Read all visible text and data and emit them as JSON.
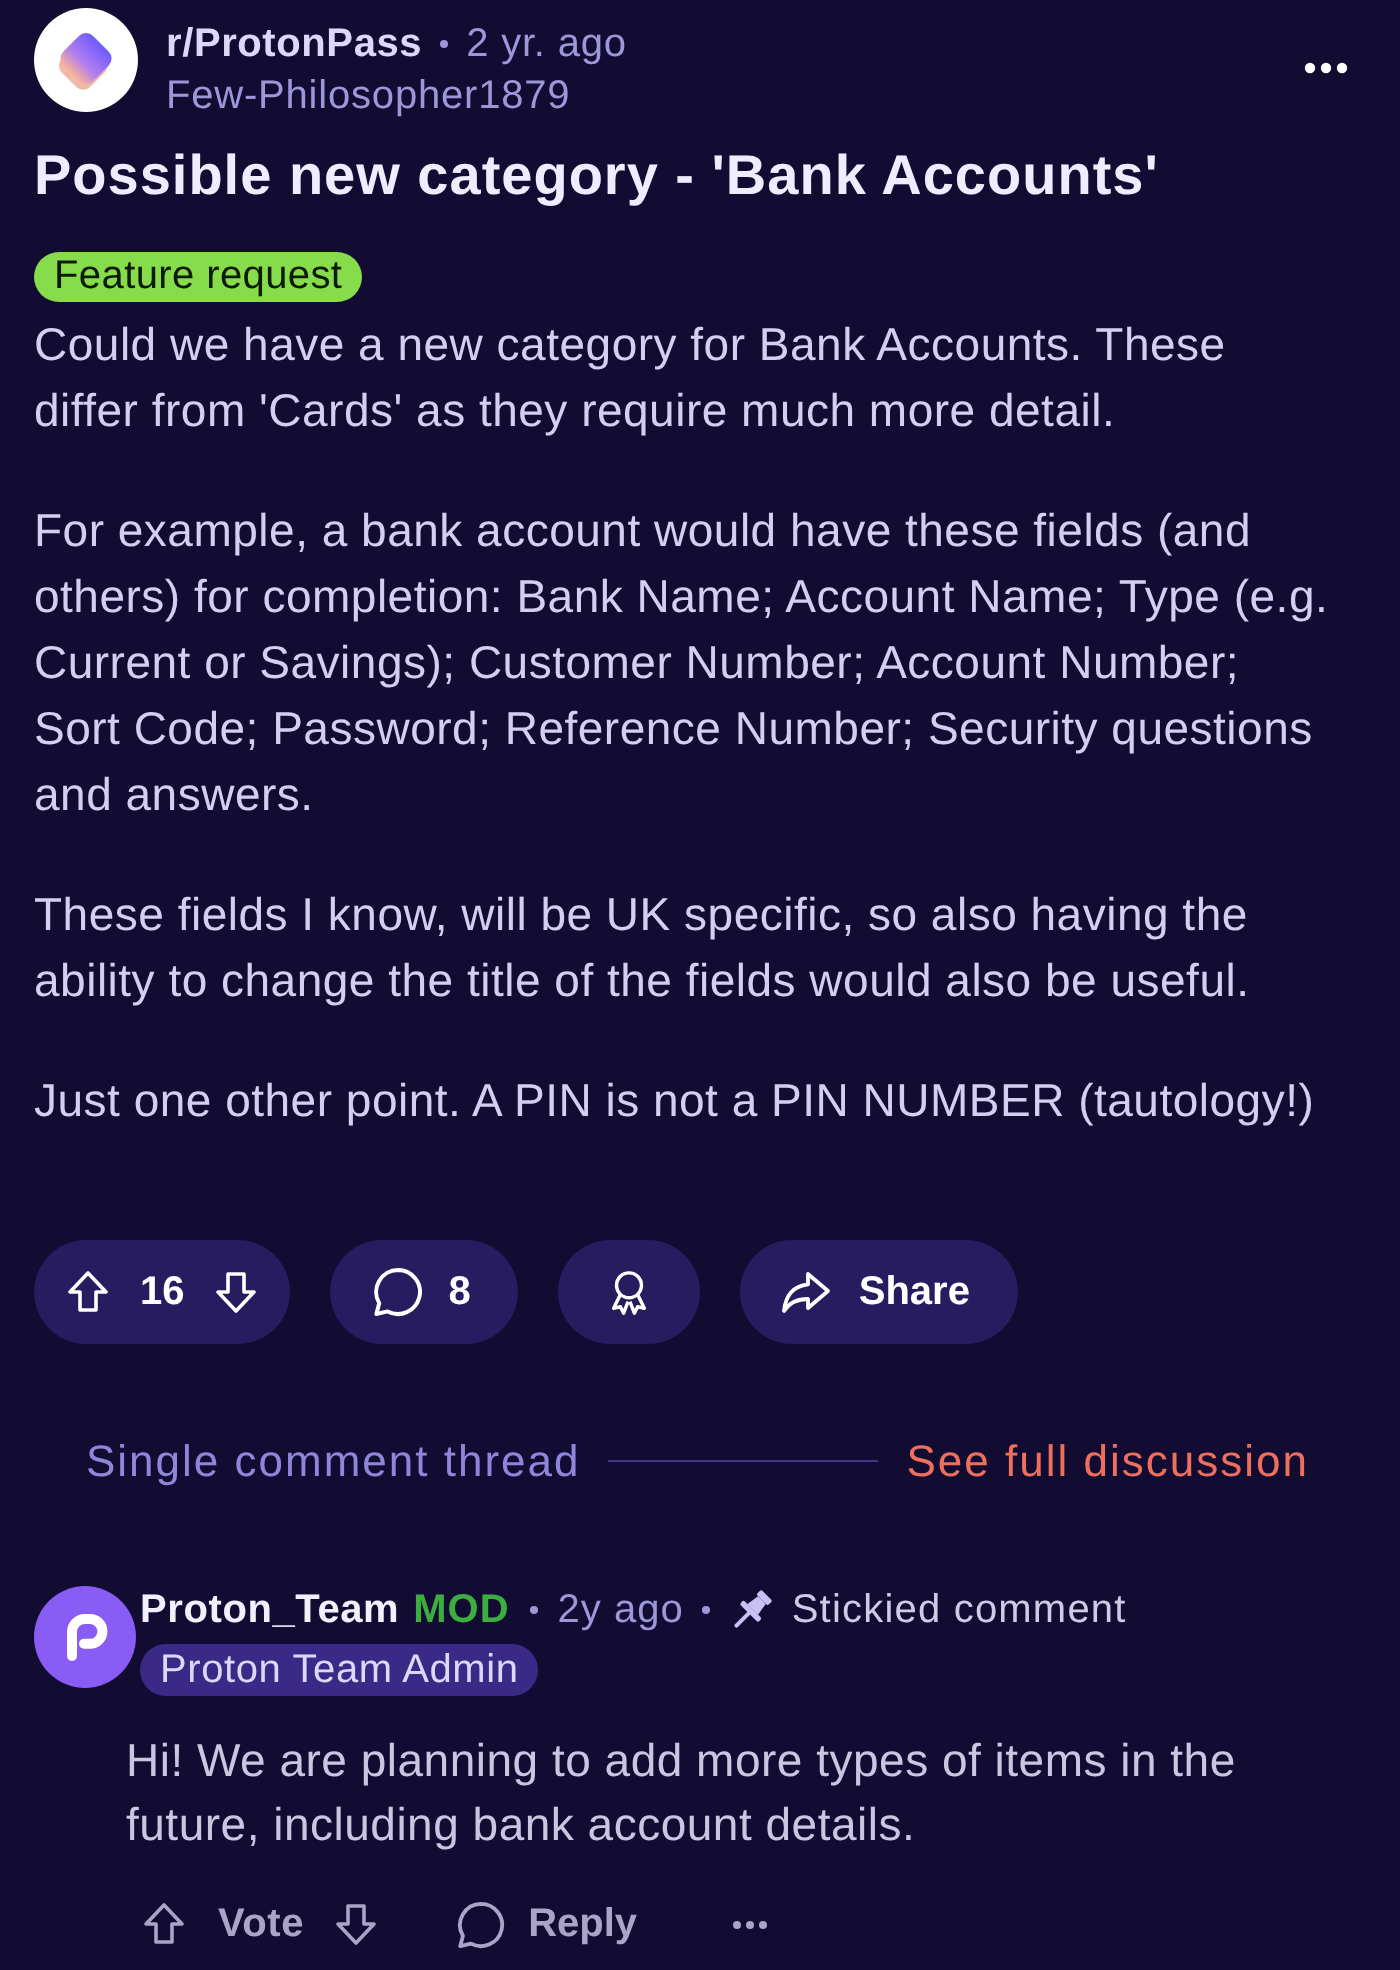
{
  "post": {
    "subreddit": "r/ProtonPass",
    "age": "2 yr. ago",
    "author": "Few-Philosopher1879",
    "title": "Possible new category - 'Bank Accounts'",
    "flair": "Feature request",
    "body": [
      "Could we have a new category for Bank Accounts. These differ from 'Cards' as they require much more detail.",
      "For example, a bank account would have these fields (and others) for completion: Bank Name; Account Name; Type (e.g. Current or Savings); Customer Number; Account Number; Sort Code; Password; Reference Number; Security questions and answers.",
      "These fields I know, will be UK specific, so also having the ability to change the title of the fields would also be useful.",
      "Just one other point. A PIN is not a PIN NUMBER (tautology!)"
    ],
    "score": "16",
    "comment_count": "8",
    "share_label": "Share"
  },
  "thread_bar": {
    "label": "Single comment thread",
    "link": "See full discussion"
  },
  "comments": [
    {
      "author": "Proton_Team",
      "badge": "MOD",
      "age": "2y ago",
      "sticky_label": "Stickied comment",
      "flair": "Proton Team Admin",
      "body": "Hi! We are planning to add more types of items in the future, including bank account details.",
      "vote_label": "Vote",
      "reply_label": "Reply"
    }
  ]
}
